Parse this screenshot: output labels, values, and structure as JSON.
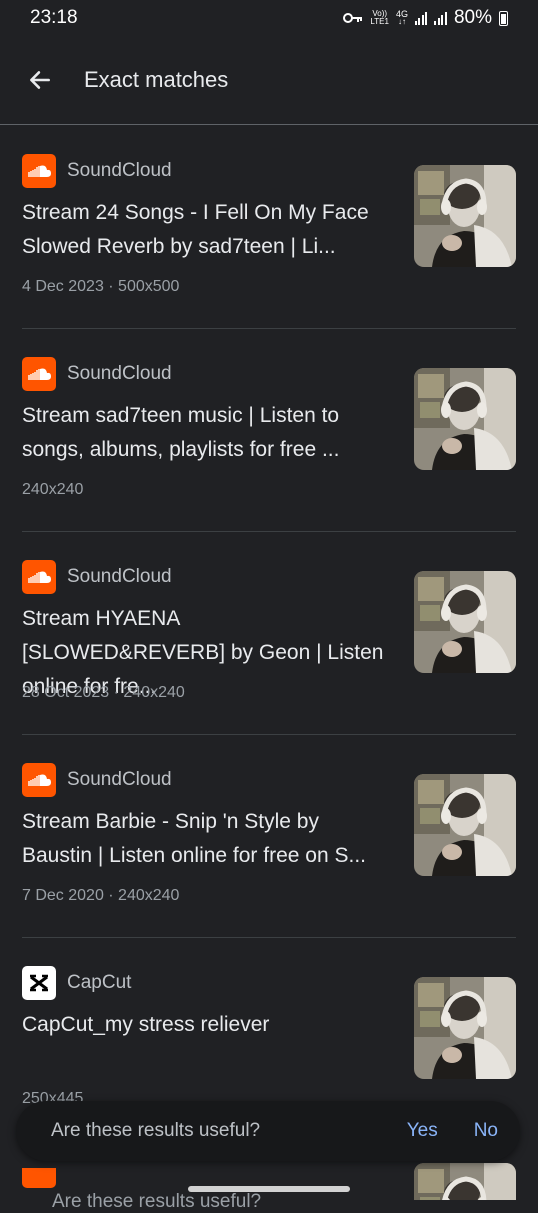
{
  "status_bar": {
    "time": "23:18",
    "volte_top": "Vo))",
    "volte_bottom": "LTE1",
    "network": "4G",
    "battery": "80%",
    "icons": [
      "key-icon",
      "volte-icon",
      "network-4g-icon",
      "signal-icon",
      "signal-icon",
      "battery-icon"
    ]
  },
  "header": {
    "title": "Exact matches",
    "back_icon": "arrow-left-icon"
  },
  "results": [
    {
      "source": "SoundCloud",
      "icon": "soundcloud-icon",
      "title": "Stream 24 Songs - I Fell On My Face Slowed Reverb by sad7teen | Li...",
      "meta": "4 Dec 2023 · 500x500"
    },
    {
      "source": "SoundCloud",
      "icon": "soundcloud-icon",
      "title": "Stream sad7teen music | Listen to songs, albums, playlists for free ...",
      "meta": "240x240"
    },
    {
      "source": "SoundCloud",
      "icon": "soundcloud-icon",
      "title": "Stream HYAENA [SLOWED&REVERB] by Geon | Listen online for fre...",
      "meta": "28 Oct 2023 · 240x240"
    },
    {
      "source": "SoundCloud",
      "icon": "soundcloud-icon",
      "title": "Stream Barbie - Snip 'n Style by Baustin | Listen online for free on S...",
      "meta": "7 Dec 2020 · 240x240"
    },
    {
      "source": "CapCut",
      "icon": "capcut-icon",
      "title": "CapCut_my stress reliever",
      "meta": "250x445"
    }
  ],
  "snackbar": {
    "question": "Are these results useful?",
    "yes": "Yes",
    "no": "No"
  },
  "peek_text": "Are these results useful?",
  "colors": {
    "background": "#202124",
    "accent": "#8ab4f8",
    "soundcloud": "#ff5500"
  }
}
